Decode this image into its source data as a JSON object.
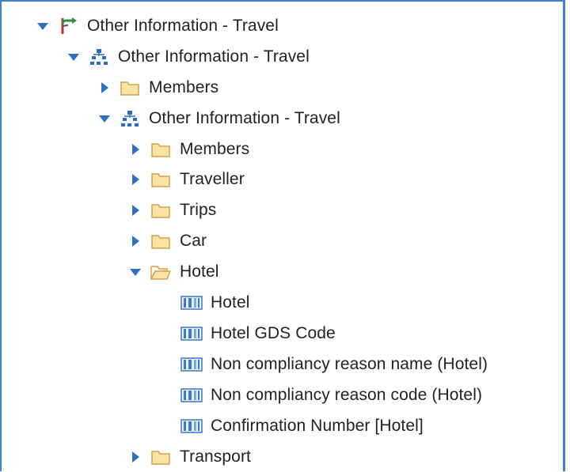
{
  "tree": {
    "nodes": [
      {
        "label": "Other Information - Travel",
        "icon": "package-icon",
        "state": "expanded",
        "level": 0
      },
      {
        "label": "Other Information - Travel",
        "icon": "hierarchy-icon",
        "state": "expanded",
        "level": 1
      },
      {
        "label": "Members",
        "icon": "folder-icon",
        "state": "collapsed",
        "level": 2
      },
      {
        "label": "Other Information - Travel",
        "icon": "hierarchy-icon",
        "state": "expanded",
        "level": 2
      },
      {
        "label": "Members",
        "icon": "folder-icon",
        "state": "collapsed",
        "level": 3
      },
      {
        "label": "Traveller",
        "icon": "folder-icon",
        "state": "collapsed",
        "level": 3
      },
      {
        "label": "Trips",
        "icon": "folder-icon",
        "state": "collapsed",
        "level": 3
      },
      {
        "label": "Car",
        "icon": "folder-icon",
        "state": "collapsed",
        "level": 3
      },
      {
        "label": "Hotel",
        "icon": "folder-open-icon",
        "state": "expanded",
        "level": 3
      },
      {
        "label": "Hotel",
        "icon": "level-icon",
        "state": "leaf",
        "level": 4
      },
      {
        "label": "Hotel GDS Code",
        "icon": "level-icon",
        "state": "leaf",
        "level": 4
      },
      {
        "label": "Non compliancy reason name (Hotel)",
        "icon": "level-icon",
        "state": "leaf",
        "level": 4
      },
      {
        "label": "Non compliancy reason code (Hotel)",
        "icon": "level-icon",
        "state": "leaf",
        "level": 4
      },
      {
        "label": "Confirmation Number [Hotel]",
        "icon": "level-icon",
        "state": "leaf",
        "level": 4
      },
      {
        "label": "Transport",
        "icon": "folder-icon",
        "state": "collapsed",
        "level": 3
      }
    ]
  },
  "colors": {
    "border": "#3f7fd6",
    "twisty": "#2f6fc4",
    "folder_fill": "#fbe3a6",
    "folder_stroke": "#d4a24a",
    "hierarchy": "#2a6cc8",
    "level": "#3a78c9"
  }
}
